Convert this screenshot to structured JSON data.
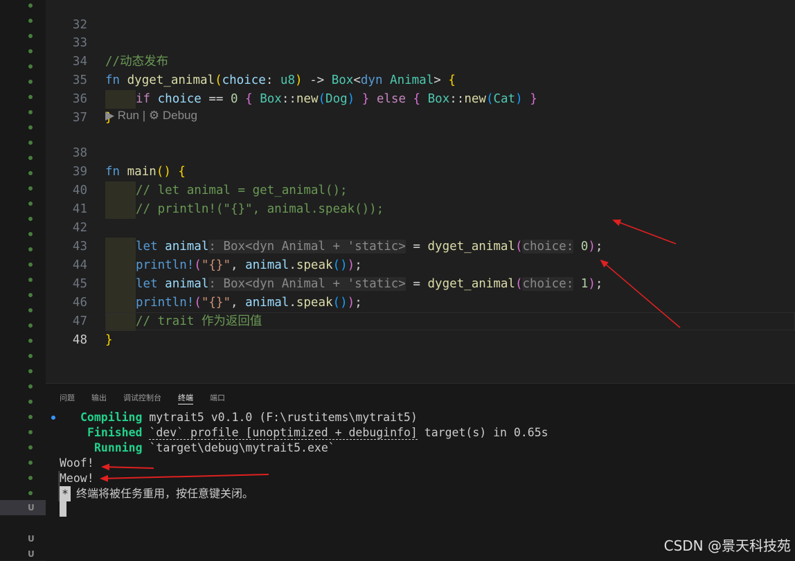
{
  "gutter": {
    "markers": [
      "U",
      "U",
      "U"
    ]
  },
  "code_lens": {
    "run_label": "Run",
    "separator": "|",
    "debug_label": "Debug"
  },
  "editor": {
    "line_numbers": [
      "32",
      "33",
      "34",
      "35",
      "36",
      "37",
      "38",
      "39",
      "40",
      "41",
      "42",
      "43",
      "44",
      "45",
      "46",
      "47",
      "48"
    ],
    "tokens": {
      "l33_comment": "//动态发布",
      "fn": "fn",
      "fn_dyget": "dyget_animal",
      "param_choice": "choice",
      "colon": ":",
      "u8": "u8",
      "arrow": "->",
      "box": "Box",
      "dyn": "dyn",
      "animal_trait": "Animal",
      "lt": "<",
      "gt": ">",
      "open_paren": "(",
      "close_paren": ")",
      "open_brace": "{",
      "close_brace": "}",
      "if": "if",
      "eqeq": "==",
      "zero": "0",
      "one": "1",
      "else": "else",
      "new": "new",
      "colons": "::",
      "dog": "Dog",
      "cat": "Cat",
      "main": "main",
      "l39_comment": "// let animal = get_animal();",
      "l40_comment": "// println!(\"{}\", animal.speak());",
      "let": "let",
      "animal_var": "animal",
      "type_hint": ": Box<dyn Animal + 'static>",
      "eq": "=",
      "choice_hint": "choice:",
      "semicolon": ";",
      "println": "println!",
      "fmt_str": "\"{}\"",
      "comma": ",",
      "dot": ".",
      "speak": "speak",
      "l46_comment": "// trait 作为返回值"
    }
  },
  "panel": {
    "tabs": [
      "问题",
      "输出",
      "调试控制台",
      "终端",
      "端口"
    ],
    "active_tab": "终端",
    "terminal": {
      "compiling_label": "Compiling",
      "compiling_text": "mytrait5 v0.1.0 (F:\\rustitems\\mytrait5)",
      "finished_label": "Finished",
      "finished_profile": "`dev` profile [unoptimized + debuginfo]",
      "finished_rest": "target(s) in 0.65s",
      "running_label": "Running",
      "running_text": "`target\\debug\\mytrait5.exe`",
      "out_1": "Woof!",
      "out_2": "Meow!",
      "star": "*",
      "reuse_notice": "终端将被任务重用，按任意键关闭。"
    }
  },
  "watermark": "CSDN @景天科技苑",
  "colors": {
    "background": "#1f1f1f",
    "annotation_arrow": "#e02020",
    "terminal_green": "#23d18b"
  }
}
